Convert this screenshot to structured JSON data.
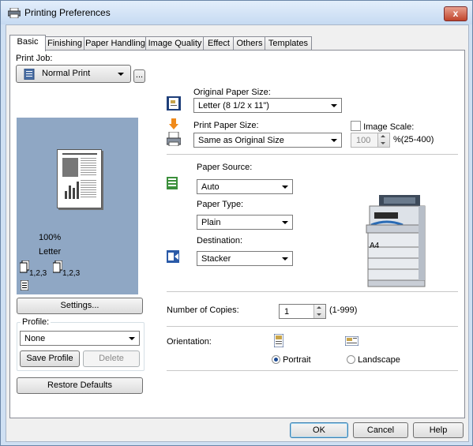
{
  "window": {
    "title": "Printing Preferences",
    "close_glyph": "x"
  },
  "tabs": [
    "Basic",
    "Finishing",
    "Paper Handling",
    "Image Quality",
    "Effect",
    "Others",
    "Templates"
  ],
  "print_job": {
    "label": "Print Job:",
    "value": "Normal Print",
    "more_button": "..."
  },
  "preview": {
    "zoom": "100%",
    "paper": "Letter",
    "collate_label_1": "1,2,3",
    "collate_label_2": "1,2,3"
  },
  "settings_button": "Settings...",
  "profile": {
    "label": "Profile:",
    "value": "None",
    "save_button": "Save Profile",
    "delete_button": "Delete"
  },
  "restore_defaults_button": "Restore Defaults",
  "original_paper_size": {
    "label": "Original Paper Size:",
    "value": "Letter (8 1/2 x 11\")"
  },
  "print_paper_size": {
    "label": "Print Paper Size:",
    "value": "Same as Original Size"
  },
  "image_scale": {
    "label": "Image Scale:",
    "value": "100",
    "range": "%(25-400)"
  },
  "paper_source": {
    "label": "Paper Source:",
    "value": "Auto"
  },
  "paper_type": {
    "label": "Paper Type:",
    "value": "Plain"
  },
  "destination": {
    "label": "Destination:",
    "value": "Stacker"
  },
  "printer_tray_label": "A4",
  "copies": {
    "label": "Number of Copies:",
    "value": "1",
    "range": "(1-999)"
  },
  "orientation": {
    "label": "Orientation:",
    "portrait": "Portrait",
    "landscape": "Landscape",
    "selected": "Portrait"
  },
  "footer": {
    "ok": "OK",
    "cancel": "Cancel",
    "help": "Help"
  },
  "colors": {
    "title_bar": "#c6daf2",
    "preview_bg": "#8fa7c4",
    "close_button": "#c0442b",
    "accent": "#1c4a93"
  }
}
